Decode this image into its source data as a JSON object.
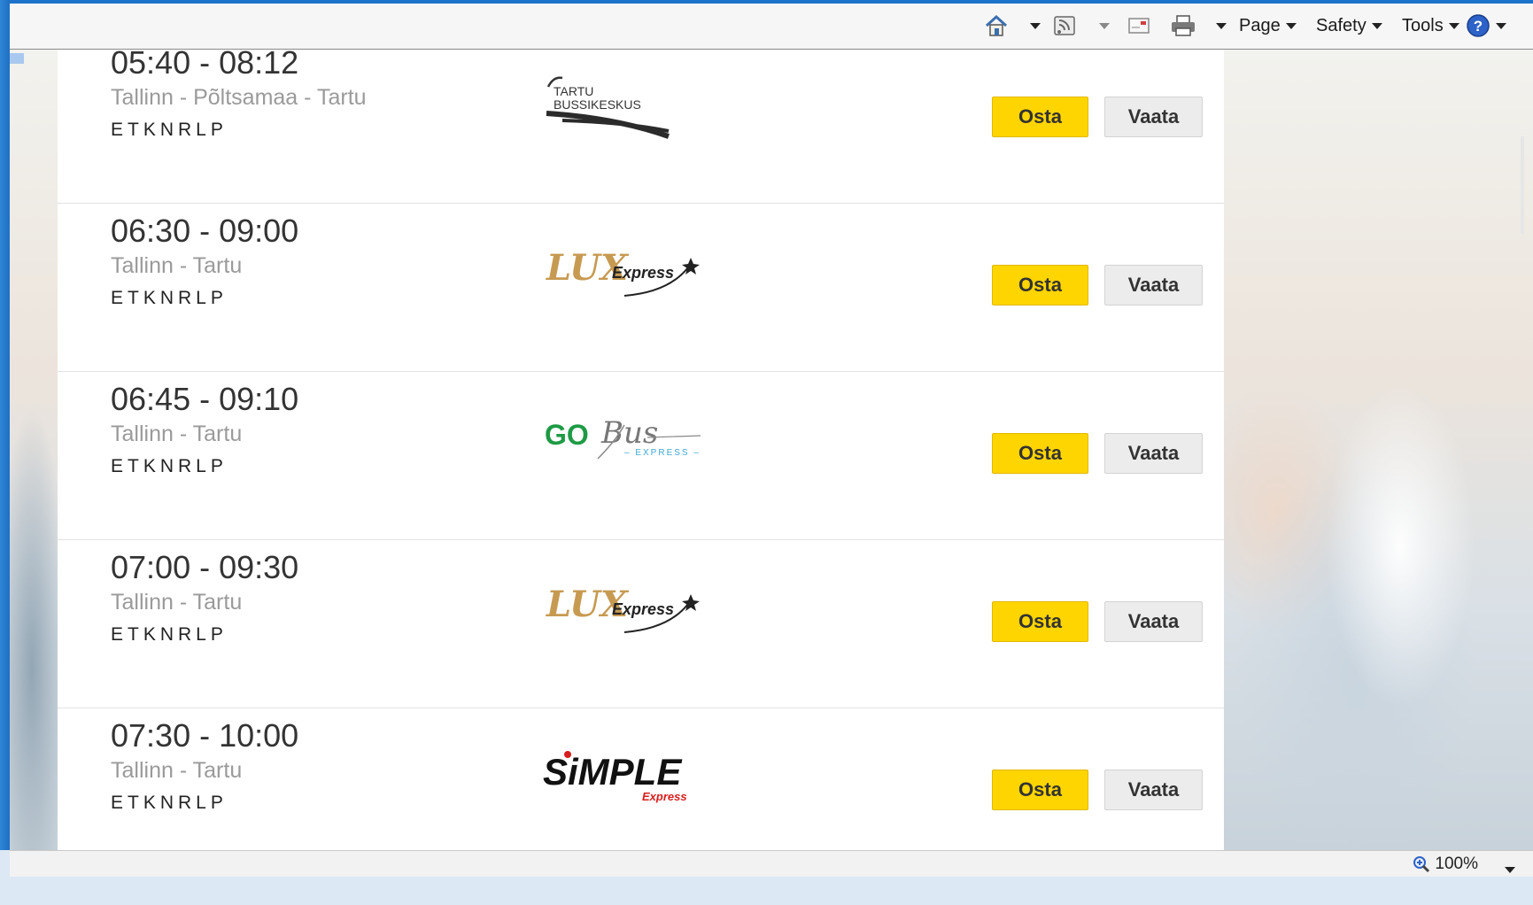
{
  "toolbar": {
    "icons": [
      "home-icon",
      "feeds-icon",
      "mail-icon",
      "print-icon",
      "help-icon"
    ],
    "page_label": "Page",
    "safety_label": "Safety",
    "tools_label": "Tools"
  },
  "trips": [
    {
      "time": "05:40 - 08:12",
      "route": "Tallinn - Põltsamaa - Tartu",
      "days": "ETKNRLP",
      "operator_logo": "Tartu Bussikeskus",
      "logo_lines": [
        "TARTU",
        "BUSSIKESKUS"
      ],
      "buy_label": "Osta",
      "view_label": "Vaata"
    },
    {
      "time": "06:30 - 09:00",
      "route": "Tallinn - Tartu",
      "days": "ETKNRLP",
      "operator_logo": "Lux Express",
      "logo_main": "LUX",
      "logo_sub": "Express",
      "buy_label": "Osta",
      "view_label": "Vaata"
    },
    {
      "time": "06:45 - 09:10",
      "route": "Tallinn - Tartu",
      "days": "ETKNRLP",
      "operator_logo": "GoBus Express",
      "logo_main": "GO",
      "logo_script": "Bus",
      "logo_sub": "– EXPRESS –",
      "buy_label": "Osta",
      "view_label": "Vaata"
    },
    {
      "time": "07:00 - 09:30",
      "route": "Tallinn - Tartu",
      "days": "ETKNRLP",
      "operator_logo": "Lux Express",
      "logo_main": "LUX",
      "logo_sub": "Express",
      "buy_label": "Osta",
      "view_label": "Vaata"
    },
    {
      "time": "07:30 - 10:00",
      "route": "Tallinn - Tartu",
      "days": "ETKNRLP",
      "operator_logo": "Simple Express",
      "logo_main": "SiMPLE",
      "logo_sub": "Express",
      "buy_label": "Osta",
      "view_label": "Vaata"
    }
  ],
  "statusbar": {
    "zoom": "100%"
  },
  "colors": {
    "buy_button": "#ffd500",
    "view_button": "#ececec",
    "frame": "#1f6fc2"
  }
}
